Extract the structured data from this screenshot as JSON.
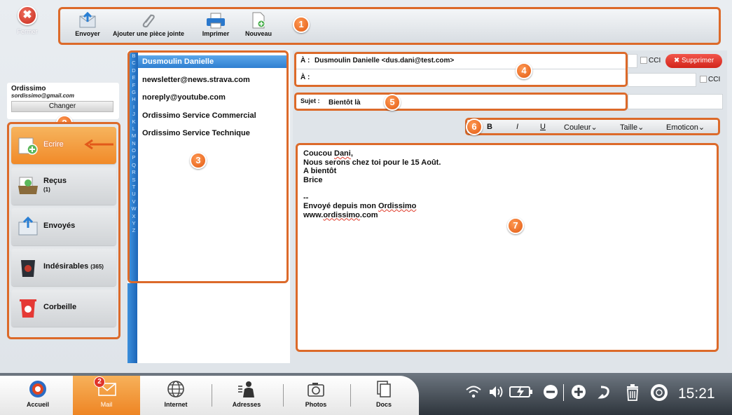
{
  "toolbar": {
    "close_label": "Fermer",
    "close_glyph": "✖",
    "buttons": [
      {
        "label": "Envoyer",
        "icon": "send-envelope-icon"
      },
      {
        "label": "Ajouter une pièce jointe",
        "icon": "paperclip-icon"
      },
      {
        "label": "Imprimer",
        "icon": "printer-icon"
      },
      {
        "label": "Nouveau",
        "icon": "new-document-icon"
      }
    ]
  },
  "badges": [
    "1",
    "2",
    "3",
    "4",
    "5",
    "6",
    "7"
  ],
  "account": {
    "name": "Ordissimo",
    "email": "sordissimo@gmail.com",
    "change_label": "Changer"
  },
  "folders": [
    {
      "label": "Ecrire",
      "count": "",
      "active": true,
      "icon": "write-pen-icon"
    },
    {
      "label": "Reçus",
      "count": "(1)",
      "active": false,
      "icon": "inbox-tray-icon"
    },
    {
      "label": "Envoyés",
      "count": "",
      "active": false,
      "icon": "sent-envelope-icon"
    },
    {
      "label": "Indésirables",
      "count": "(365)",
      "active": false,
      "icon": "spam-bin-icon"
    },
    {
      "label": "Corbeille",
      "count": "",
      "active": false,
      "icon": "trash-icon"
    }
  ],
  "contacts": {
    "alphabet": [
      "B",
      "C",
      "D",
      "E",
      "F",
      "G",
      "H",
      "I",
      "J",
      "K",
      "L",
      "M",
      "N",
      "O",
      "P",
      "Q",
      "R",
      "S",
      "T",
      "U",
      "V",
      "W",
      "X",
      "Y",
      "Z"
    ],
    "items": [
      {
        "name": "Dusmoulin Danielle",
        "selected": true
      },
      {
        "name": "newsletter@news.strava.com",
        "selected": false
      },
      {
        "name": "noreply@youtube.com",
        "selected": false
      },
      {
        "name": "Ordissimo Service Commercial",
        "selected": false
      },
      {
        "name": "Ordissimo Service Technique",
        "selected": false
      }
    ]
  },
  "compose": {
    "to_label": "À :",
    "to_value": "Dusmoulin Danielle <dus.dani@test.com>",
    "to2_label": "À :",
    "to2_value": "",
    "cci_label": "CCI",
    "delete_label": "Supprimer",
    "subject_label": "Sujet :",
    "subject_value": "Bientôt là",
    "format": {
      "bold": "B",
      "italic": "I",
      "underline": "U",
      "color": "Couleur⌄",
      "size": "Taille⌄",
      "emoticon": "Emoticon⌄"
    },
    "body": {
      "greeting_pre": "Coucou ",
      "greeting_name": "Dani",
      "greeting_post": ",",
      "line2": "Nous serons chez toi pour le 15 Août.",
      "line3": "A bientôt",
      "line4": "Brice",
      "sig_sep": "--",
      "sig1_pre": "Envoyé depuis mon ",
      "sig1_brand": "Ordissimo",
      "sig2_pre": "www.",
      "sig2_brand": "ordissimo",
      "sig2_post": ".com"
    }
  },
  "taskbar": {
    "items": [
      {
        "label": "Accueil",
        "icon": "home-logo-icon",
        "active": false
      },
      {
        "label": "Mail",
        "icon": "mail-icon",
        "active": true,
        "badge": "2"
      },
      {
        "label": "Internet",
        "icon": "globe-icon",
        "active": false
      },
      {
        "label": "Adresses",
        "icon": "contacts-icon",
        "active": false
      },
      {
        "label": "Photos",
        "icon": "camera-icon",
        "active": false
      },
      {
        "label": "Docs",
        "icon": "documents-icon",
        "active": false
      }
    ],
    "clock": "15:21",
    "system_icons": [
      "wifi-icon",
      "volume-icon",
      "battery-icon",
      "zoom-out-icon",
      "zoom-in-icon",
      "undo-icon",
      "trash-icon",
      "help-icon"
    ]
  },
  "colors": {
    "accent_orange": "#dc6a2a",
    "selection_blue": "#2f7fd1",
    "delete_red": "#d2251b"
  }
}
